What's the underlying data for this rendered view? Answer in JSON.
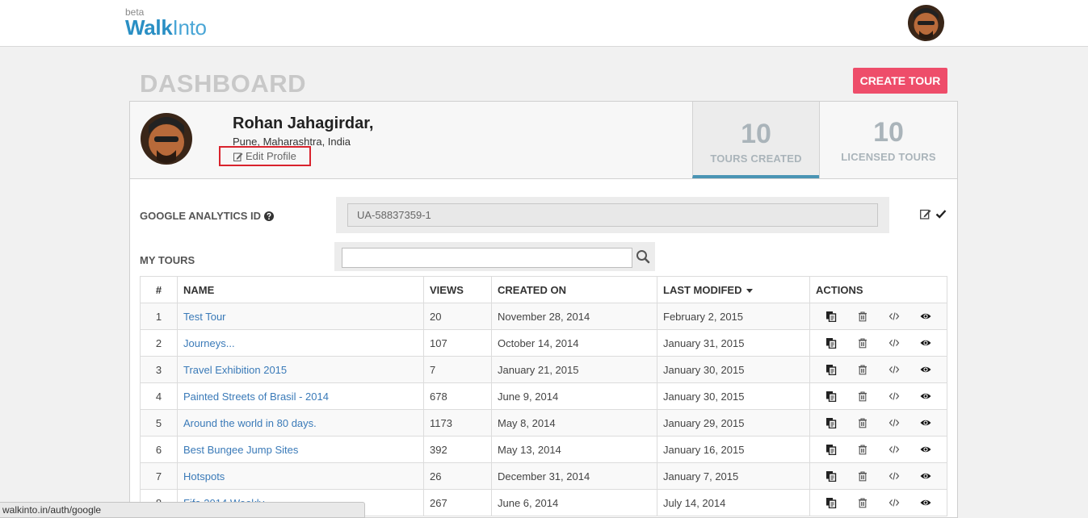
{
  "brand": {
    "beta": "beta",
    "word1": "Walk",
    "word2": "Into"
  },
  "page": {
    "title": "DASHBOARD",
    "create_label": "CREATE TOUR"
  },
  "profile": {
    "name": "Rohan Jahagirdar,",
    "location": "Pune, Maharashtra, India",
    "edit_label": "Edit Profile"
  },
  "stats": [
    {
      "value": "10",
      "label": "TOURS CREATED"
    },
    {
      "value": "10",
      "label": "LICENSED TOURS"
    }
  ],
  "analytics": {
    "label": "GOOGLE ANALYTICS ID",
    "value": "UA-58837359-1"
  },
  "my_tours": {
    "label": "MY TOURS",
    "search_value": ""
  },
  "table": {
    "headers": [
      "#",
      "NAME",
      "VIEWS",
      "CREATED ON",
      "LAST MODIFED",
      "ACTIONS"
    ],
    "rows": [
      {
        "num": "1",
        "name": "Test Tour",
        "views": "20",
        "created": "November 28, 2014",
        "modified": "February 2, 2015"
      },
      {
        "num": "2",
        "name": "Journeys...",
        "views": "107",
        "created": "October 14, 2014",
        "modified": "January 31, 2015"
      },
      {
        "num": "3",
        "name": "Travel Exhibition 2015",
        "views": "7",
        "created": "January 21, 2015",
        "modified": "January 30, 2015"
      },
      {
        "num": "4",
        "name": "Painted Streets of Brasil - 2014",
        "views": "678",
        "created": "June 9, 2014",
        "modified": "January 30, 2015"
      },
      {
        "num": "5",
        "name": "Around the world in 80 days.",
        "views": "1173",
        "created": "May 8, 2014",
        "modified": "January 29, 2015"
      },
      {
        "num": "6",
        "name": "Best Bungee Jump Sites",
        "views": "392",
        "created": "May 13, 2014",
        "modified": "January 16, 2015"
      },
      {
        "num": "7",
        "name": "Hotspots",
        "views": "26",
        "created": "December 31, 2014",
        "modified": "January 7, 2015"
      },
      {
        "num": "8",
        "name": "Fifa 2014 Weekly",
        "views": "267",
        "created": "June 6, 2014",
        "modified": "July 14, 2014"
      }
    ],
    "row_actions": [
      "copy-icon",
      "trash-icon",
      "code-icon",
      "eye-icon"
    ]
  },
  "status_bar": {
    "url": "walkinto.in/auth/google"
  },
  "colors": {
    "brand_blue": "#2a8fc4",
    "create_button": "#ee4d6a",
    "link": "#3a7ab8",
    "stat_underline": "#4a94b4",
    "highlight_box": "#d9232d"
  }
}
